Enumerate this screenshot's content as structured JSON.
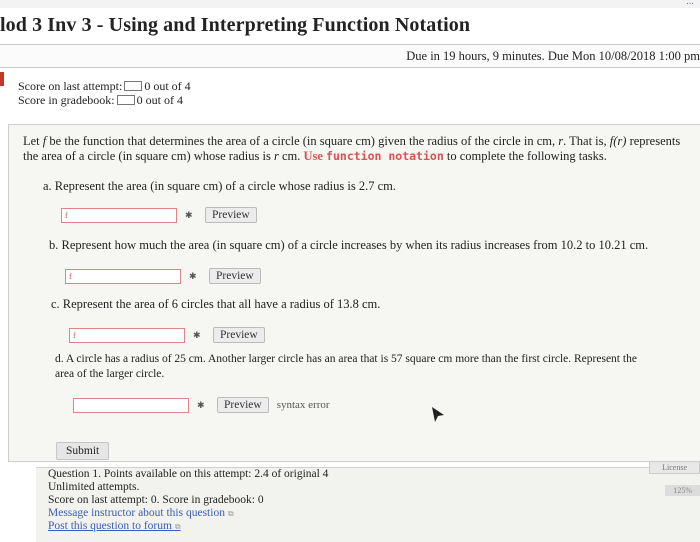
{
  "header": {
    "title": "lod 3 Inv 3 - Using and Interpreting Function Notation",
    "due_text": "Due in 19 hours, 9 minutes. Due Mon 10/08/2018 1:00 pm"
  },
  "scores": {
    "last_label": "Score on last attempt:",
    "last_value": "0 out of 4",
    "gradebook_label": "Score in gradebook:",
    "gradebook_value": "0 out of 4"
  },
  "question": {
    "intro_1": "Let",
    "intro_f": "f",
    "intro_2": "be the function that determines the area of a circle (in square cm) given the radius of the circle in cm,",
    "intro_r": "r",
    "intro_3": ". That is,",
    "intro_fr": "f(r)",
    "intro_4": "represents the area of a circle (in square cm) whose radius is",
    "intro_r2": "r",
    "intro_5": "cm.",
    "intro_use": "Use",
    "intro_code": "function notation",
    "intro_6": "to complete the following tasks.",
    "tasks": [
      {
        "label": "a. Represent the area (in square cm) of a circle whose radius is 2.7 cm.",
        "input_value": "f"
      },
      {
        "label": "b. Represent how much the area (in square cm) of a circle increases by when its radius increases from 10.2 to 10.21 cm.",
        "input_value": "f"
      },
      {
        "label": "c. Represent the area of 6 circles that all have a radius of 13.8 cm.",
        "input_value": "f"
      },
      {
        "label": "d. A circle has a radius of 25 cm. Another larger circle has an area that is 57 square cm more than the first circle. Represent the area of the larger circle.",
        "input_value": ""
      }
    ],
    "preview_label": "Preview",
    "syntax_error": "syntax error",
    "submit_label": "Submit"
  },
  "footer": {
    "line1": "Question 1. Points available on this attempt: 2.4 of original 4",
    "line2": "Unlimited attempts.",
    "line3": "Score on last attempt: 0. Score in gradebook: 0",
    "message_link": "Message instructor about this question",
    "forum_link": "Post this question to forum",
    "license": "License",
    "zoom": "125%"
  }
}
